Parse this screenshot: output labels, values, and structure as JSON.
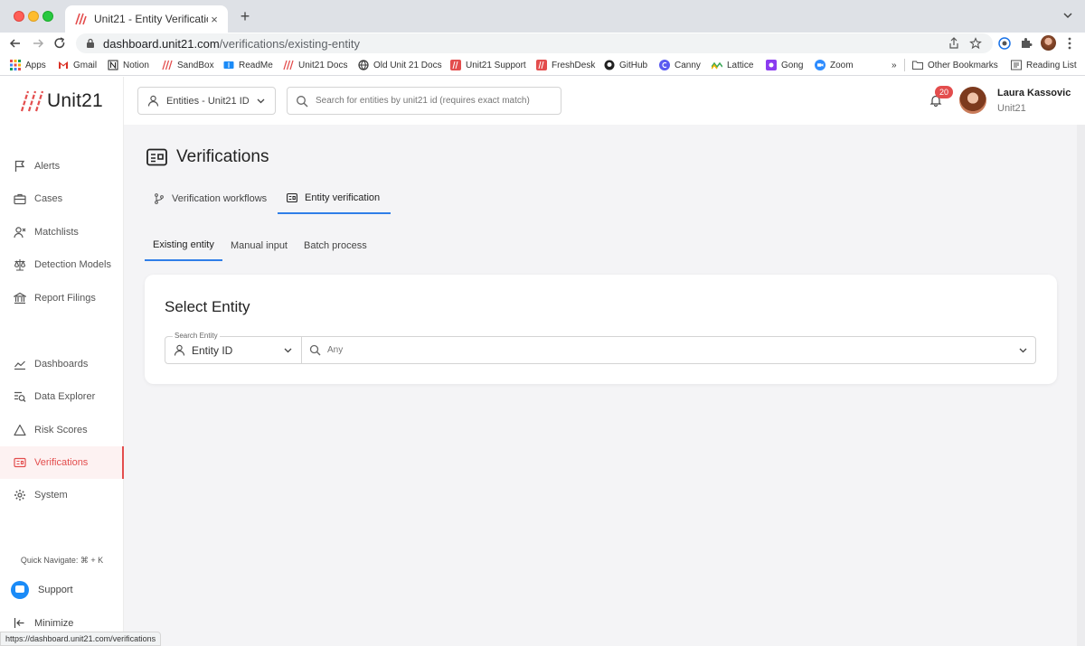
{
  "browser": {
    "tab_title": "Unit21 - Entity Verifications",
    "tab_close": "×",
    "new_tab": "+",
    "url_host": "dashboard.unit21.com",
    "url_path": "/verifications/existing-entity",
    "bookmarks": [
      "Apps",
      "Gmail",
      "Notion",
      "SandBox",
      "ReadMe",
      "Unit21 Docs",
      "Old Unit 21 Docs",
      "Unit21 Support",
      "FreshDesk",
      "GitHub",
      "Canny",
      "Lattice",
      "Gong",
      "Zoom"
    ],
    "bookmarks_overflow": "»",
    "other_bookmarks": "Other Bookmarks",
    "reading_list": "Reading List",
    "status_url": "https://dashboard.unit21.com/verifications"
  },
  "app": {
    "logo_text": "Unit21",
    "brand_color": "#e34d4d",
    "accent_color": "#2f7ee8"
  },
  "sidebar": {
    "items": [
      {
        "label": "Alerts",
        "icon": "flag-icon"
      },
      {
        "label": "Cases",
        "icon": "briefcase-icon"
      },
      {
        "label": "Matchlists",
        "icon": "user-x-icon"
      },
      {
        "label": "Detection Models",
        "icon": "scale-icon"
      },
      {
        "label": "Report Filings",
        "icon": "bank-icon"
      },
      {
        "label": "Dashboards",
        "icon": "chart-line-icon"
      },
      {
        "label": "Data Explorer",
        "icon": "search-list-icon"
      },
      {
        "label": "Risk Scores",
        "icon": "warning-icon"
      },
      {
        "label": "Verifications",
        "icon": "id-card-icon"
      },
      {
        "label": "System",
        "icon": "gear-icon"
      }
    ],
    "quick_navigate": "Quick Navigate: ⌘ + K",
    "support": "Support",
    "minimize": "Minimize"
  },
  "header": {
    "entity_select": "Entities - Unit21 ID",
    "search_placeholder": "Search for entities by unit21 id (requires exact match)",
    "notification_count": "20",
    "user_name": "Laura Kassovic",
    "user_org": "Unit21"
  },
  "page": {
    "title": "Verifications",
    "tabs": [
      "Verification workflows",
      "Entity verification"
    ],
    "subtabs": [
      "Existing entity",
      "Manual input",
      "Batch process"
    ]
  },
  "card": {
    "title": "Select Entity",
    "legend": "Search Entity",
    "type_value": "Entity ID",
    "search_placeholder": "Any"
  }
}
